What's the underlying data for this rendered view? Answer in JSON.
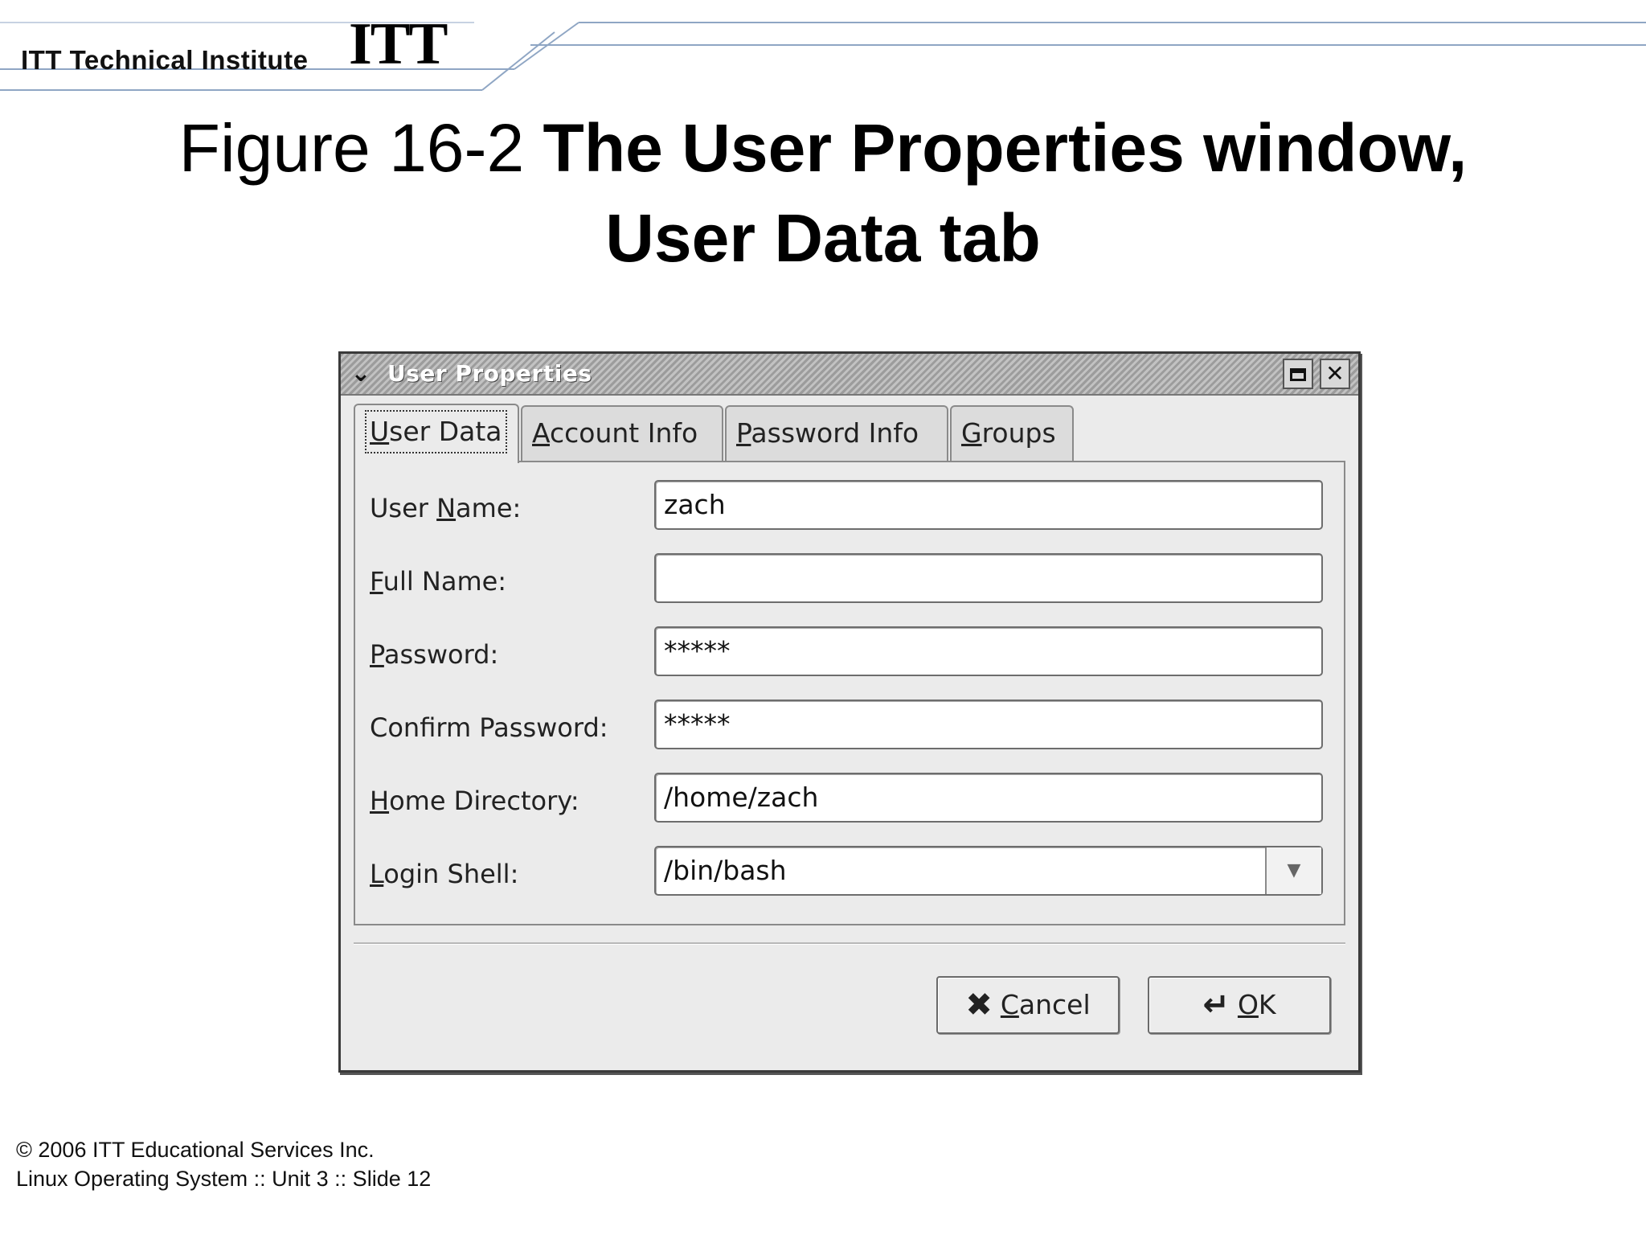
{
  "slide": {
    "brand_text": "ITT Technical Institute",
    "brand_logo": "ITT",
    "figure_label": "Figure 16-2",
    "title_line1": "The User Properties window,",
    "title_line2": "User Data tab",
    "footer_line1": "© 2006 ITT Educational Services Inc.",
    "footer_line2": "Linux Operating System :: Unit 3 :: Slide 12"
  },
  "window": {
    "title": "User Properties",
    "menu_icon": "chevron-down-icon",
    "maximize_icon": "maximize-icon",
    "close_icon": "close-icon"
  },
  "tabs": [
    {
      "pre": "",
      "key": "U",
      "post": "ser Data",
      "active": true
    },
    {
      "pre": "",
      "key": "A",
      "post": "ccount Info",
      "active": false
    },
    {
      "pre": "",
      "key": "P",
      "post": "assword Info",
      "active": false
    },
    {
      "pre": "",
      "key": "G",
      "post": "roups",
      "active": false
    }
  ],
  "fields": [
    {
      "label_pre": "User ",
      "label_key": "N",
      "label_post": "ame:",
      "value": "zach"
    },
    {
      "label_pre": "",
      "label_key": "F",
      "label_post": "ull Name:",
      "value": ""
    },
    {
      "label_pre": "",
      "label_key": "P",
      "label_post": "assword:",
      "value": "*****"
    },
    {
      "label_pre": "Conf",
      "label_key": "i",
      "label_post": "rm Password:",
      "value": "*****"
    },
    {
      "label_pre": "",
      "label_key": "H",
      "label_post": "ome Directory:",
      "value": "/home/zach"
    },
    {
      "label_pre": "",
      "label_key": "L",
      "label_post": "ogin Shell:",
      "value": "/bin/bash"
    }
  ],
  "buttons": {
    "cancel": {
      "key": "C",
      "post": "ancel",
      "icon": "x-icon"
    },
    "ok": {
      "key": "O",
      "post": "K",
      "icon": "ok-icon"
    }
  }
}
